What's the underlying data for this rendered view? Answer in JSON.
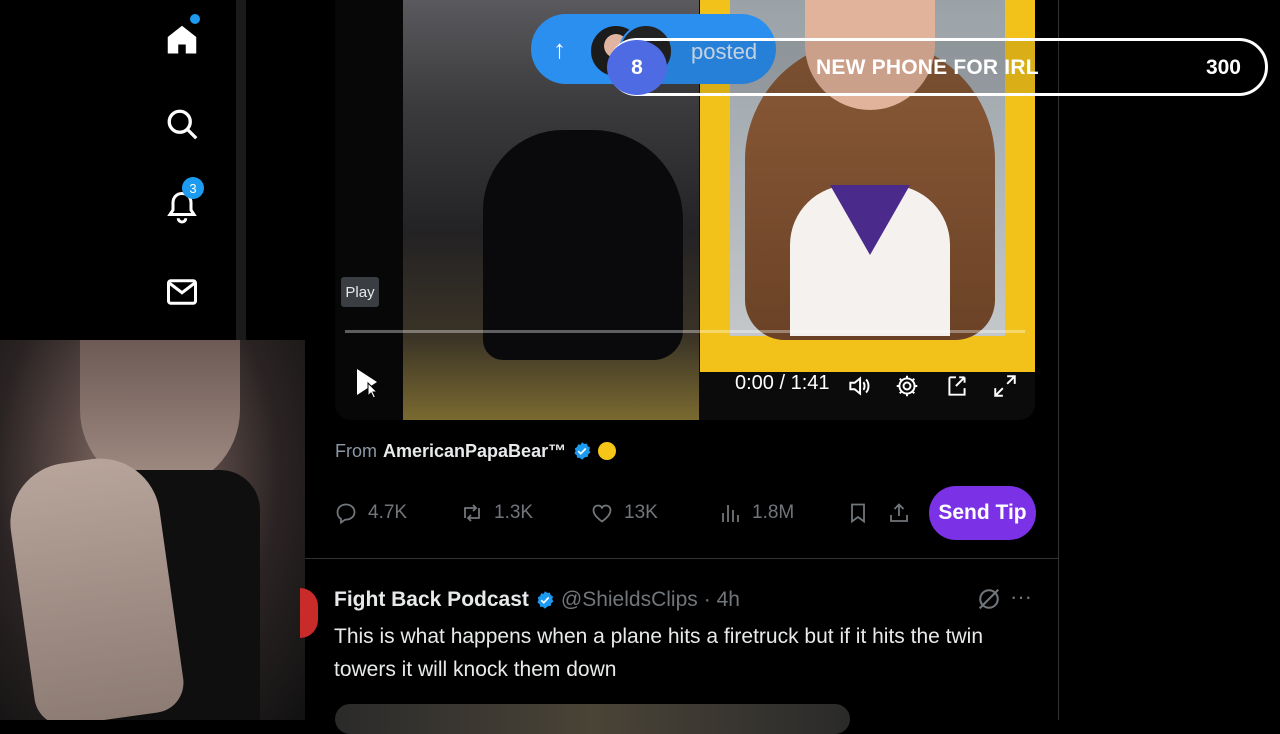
{
  "nav": {
    "items": [
      {
        "name": "home",
        "icon": "home-icon"
      },
      {
        "name": "search",
        "icon": "search-icon"
      },
      {
        "name": "notifications",
        "icon": "bell-icon",
        "badge": "3"
      },
      {
        "name": "messages",
        "icon": "mail-icon"
      }
    ]
  },
  "video": {
    "tooltip": "Play",
    "time": "0:00 / 1:41"
  },
  "overlay": {
    "hype_text": "posted",
    "hype_count": "8",
    "goal_title": "NEW PHONE FOR IRL",
    "goal_amount": "300"
  },
  "post1": {
    "from_prefix": "From",
    "from_name": "AmericanPapaBear™",
    "replies": "4.7K",
    "reposts": "1.3K",
    "likes": "13K",
    "views": "1.8M",
    "tip_label": "Send Tip"
  },
  "post2": {
    "name": "Fight Back Podcast",
    "handle": "@ShieldsClips",
    "time": "· 4h",
    "more": "···",
    "text": "This is what happens when a plane hits a firetruck but if it hits the twin towers it will knock them down"
  },
  "colors": {
    "accent": "#1d9bf0",
    "tip": "#7b32e6",
    "goal_border": "#ffffff",
    "hype_bg": "#2b8ff0"
  }
}
